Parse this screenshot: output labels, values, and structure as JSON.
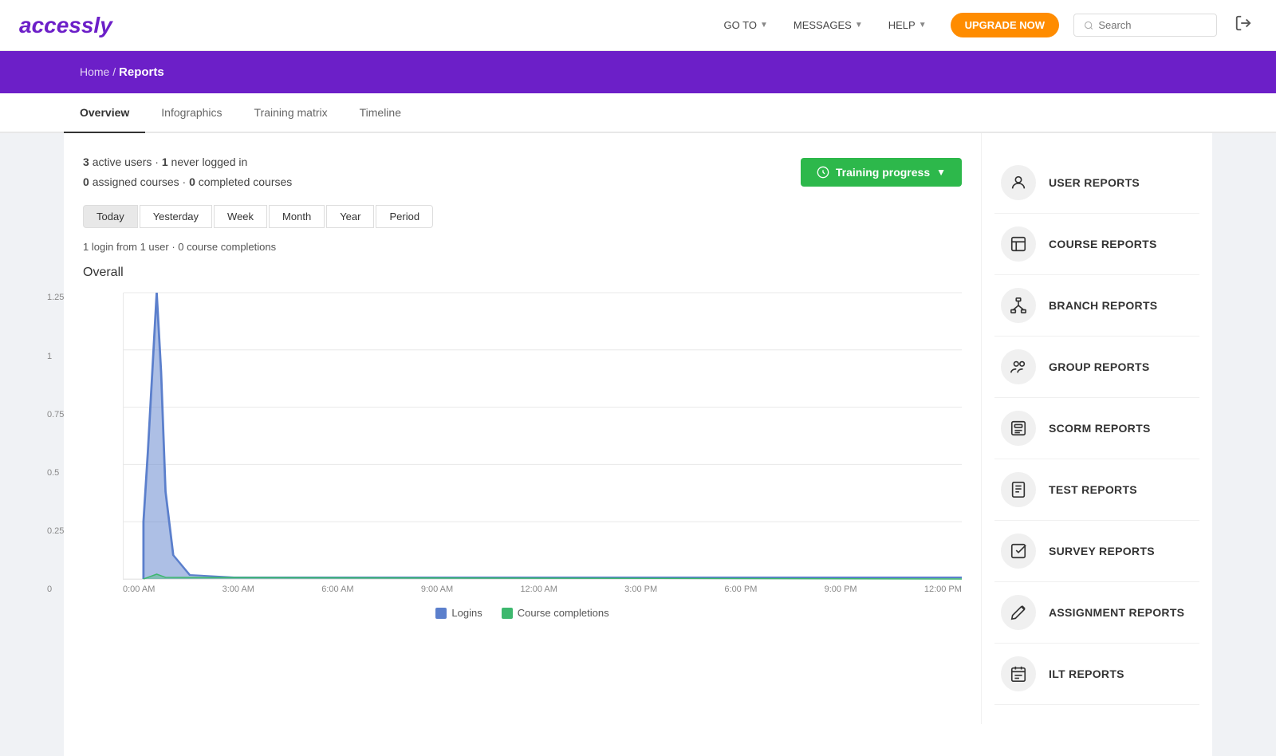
{
  "header": {
    "logo": "accessly",
    "nav": [
      {
        "label": "GO TO",
        "hasDropdown": true
      },
      {
        "label": "MESSAGES",
        "hasDropdown": true
      },
      {
        "label": "HELP",
        "hasDropdown": true
      }
    ],
    "upgrade_label": "UPGRADE NOW",
    "search_placeholder": "Search",
    "logout_icon": "→"
  },
  "breadcrumb": {
    "home": "Home",
    "separator": " / ",
    "current": "Reports"
  },
  "tabs": [
    {
      "label": "Overview",
      "active": true
    },
    {
      "label": "Infographics",
      "active": false
    },
    {
      "label": "Training matrix",
      "active": false
    },
    {
      "label": "Timeline",
      "active": false
    }
  ],
  "stats": {
    "active_users": "3",
    "active_users_label": "active users",
    "never_logged_in": "1",
    "never_logged_in_label": "never logged in",
    "assigned_courses": "0",
    "assigned_label": "assigned courses",
    "completed_courses": "0",
    "completed_label": "completed courses"
  },
  "training_progress_btn": "Training progress",
  "period_buttons": [
    {
      "label": "Today",
      "active": true
    },
    {
      "label": "Yesterday",
      "active": false
    },
    {
      "label": "Week",
      "active": false
    },
    {
      "label": "Month",
      "active": false
    },
    {
      "label": "Year",
      "active": false
    },
    {
      "label": "Period",
      "active": false
    }
  ],
  "login_info": {
    "logins": "1",
    "users": "1",
    "completions": "0"
  },
  "chart": {
    "title": "Overall",
    "y_labels": [
      "1.25",
      "1",
      "0.75",
      "0.5",
      "0.25",
      "0"
    ],
    "x_labels": [
      "0:00 AM",
      "3:00 AM",
      "6:00 AM",
      "9:00 AM",
      "12:00 AM",
      "3:00 PM",
      "6:00 PM",
      "9:00 PM",
      "12:00 PM"
    ],
    "legend": [
      {
        "label": "Logins",
        "color": "#5b7fcc"
      },
      {
        "label": "Course completions",
        "color": "#3db86e"
      }
    ]
  },
  "reports": [
    {
      "id": "user-reports",
      "label": "USER REPORTS",
      "icon": "user"
    },
    {
      "id": "course-reports",
      "label": "COURSE REPORTS",
      "icon": "course"
    },
    {
      "id": "branch-reports",
      "label": "BRANCH REPORTS",
      "icon": "branch"
    },
    {
      "id": "group-reports",
      "label": "GROUP REPORTS",
      "icon": "group"
    },
    {
      "id": "scorm-reports",
      "label": "SCORM REPORTS",
      "icon": "scorm"
    },
    {
      "id": "test-reports",
      "label": "TEST REPORTS",
      "icon": "test"
    },
    {
      "id": "survey-reports",
      "label": "SURVEY REPORTS",
      "icon": "survey"
    },
    {
      "id": "assignment-reports",
      "label": "ASSIGNMENT REPORTS",
      "icon": "assignment"
    },
    {
      "id": "ilt-reports",
      "label": "ILT REPORTS",
      "icon": "ilt"
    }
  ]
}
